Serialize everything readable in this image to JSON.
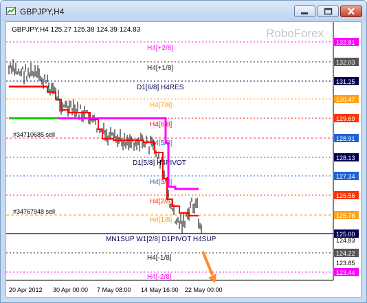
{
  "window": {
    "title": "GBPJPY,H4"
  },
  "chart": {
    "header": "GBPJPY,H4  125.27 125.38 124.39 124.83",
    "watermark": "RoboForex",
    "colors": {
      "accent_blue": "#1e63d6",
      "pink": "#ff00ff",
      "red": "#ff0000",
      "orange": "#ffa21a",
      "green": "#00cc00",
      "navy": "#000050"
    },
    "price_axis": [
      "132.81",
      "132.03",
      "131.25",
      "130.47",
      "129.69",
      "128.91",
      "128.13",
      "127.34",
      "126.56",
      "125.78",
      "125.00",
      "124.83",
      "124.22",
      "123.85",
      "123.44"
    ],
    "level_labels": [
      "H4[+2/8]",
      "H4[+1/8]",
      "D1[6/8] H4RES",
      "H4[7/8]",
      "H4[6/8]",
      "H4[5/8]",
      "D1[5/8] H4PIVOT",
      "H4[3/8]",
      "H4[2/8]",
      "H4[1/8]",
      "MN1SUP W1[2/8] D1PIVOT H4SUP",
      "H4[-1/8]",
      "H4[-2/8]"
    ],
    "order_labels": [
      "#34710685 sell",
      "#34767948 sell"
    ],
    "time_axis": [
      "20 Apr 2012",
      "30 Apr 00:00",
      "7 May 08:00",
      "14 May 16:00",
      "22 May 00:00"
    ]
  }
}
